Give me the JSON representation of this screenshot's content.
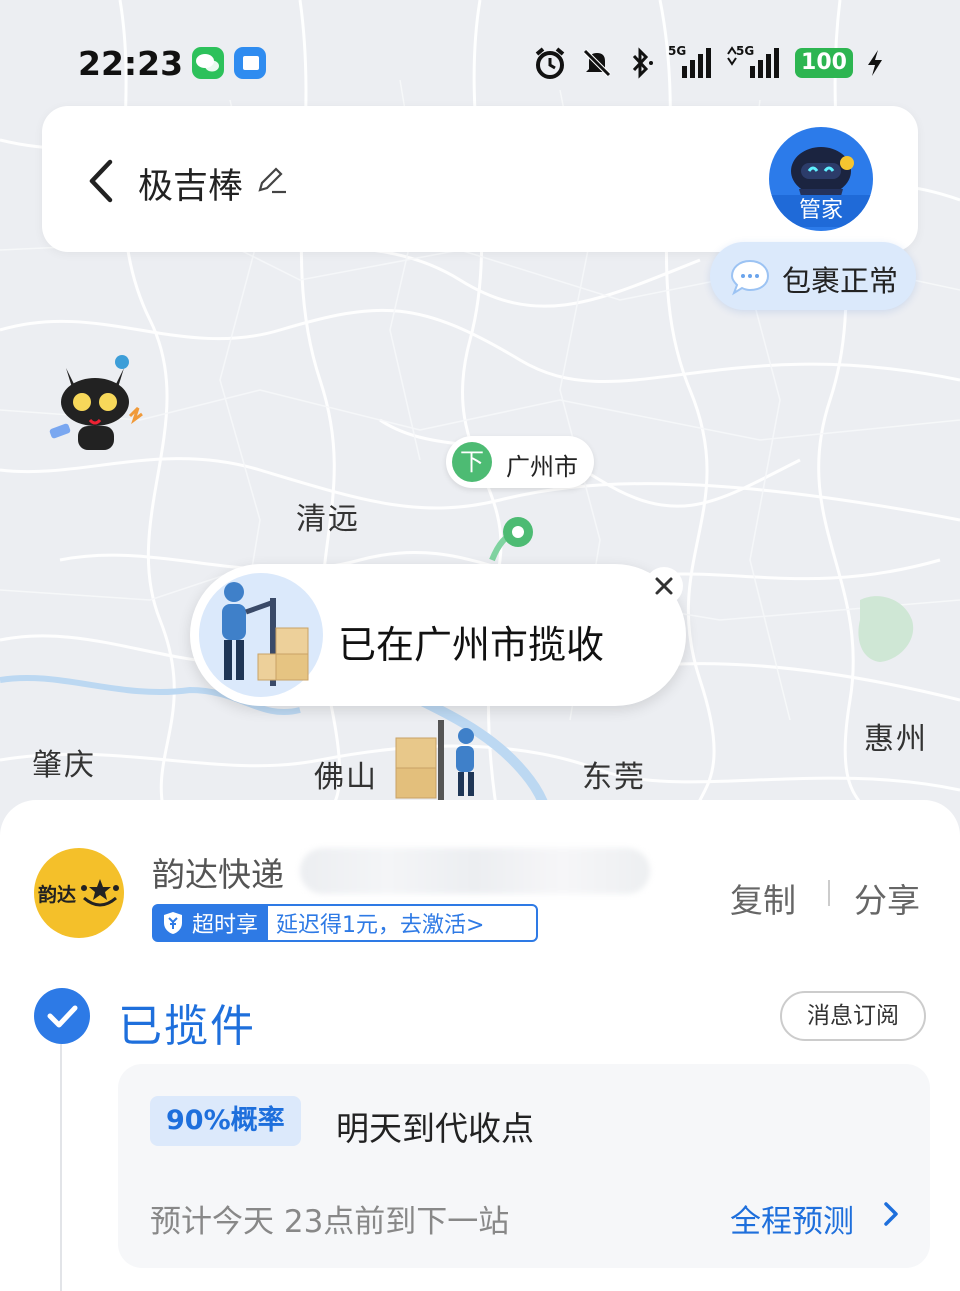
{
  "status_bar": {
    "time": "22:23",
    "signal1": "5G",
    "signal2": "5G",
    "battery": "100"
  },
  "header": {
    "title": "极吉棒",
    "butler_label": "管家"
  },
  "package_status_bubble": "包裹正常",
  "map": {
    "cities": [
      "清远",
      "肇庆",
      "佛山",
      "东莞",
      "惠州"
    ],
    "pin_badge": "下",
    "pin_city": "广州市",
    "popup_text": "已在广州市揽收"
  },
  "shipment": {
    "courier_name": "韵达快递",
    "logo_text": "韵达",
    "badge_label": "超时享",
    "badge_offer": "延迟得1元，去激活>",
    "copy_label": "复制",
    "share_label": "分享"
  },
  "tracking": {
    "state": "已揽件",
    "subscribe_label": "消息订阅",
    "probability": "90%概率",
    "prediction": "明天到代收点",
    "eta_text": "预计今天 23点前到下一站",
    "full_forecast_label": "全程预测"
  },
  "colors": {
    "accent_blue": "#1e6fdc",
    "route_green": "#4dbb73",
    "logo_yellow": "#f4c02a"
  }
}
